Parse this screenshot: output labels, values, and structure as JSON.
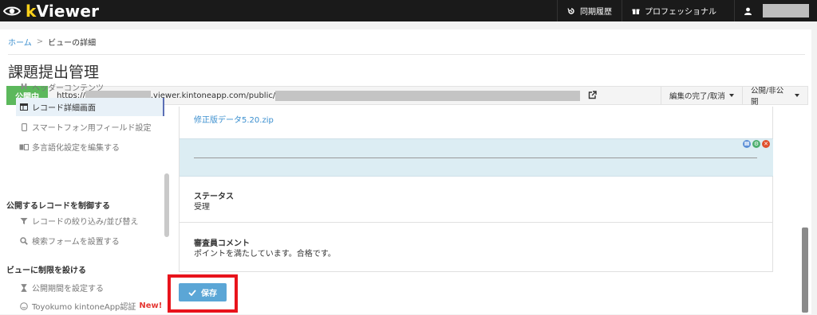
{
  "app": {
    "logo_k": "k",
    "logo_rest": "Viewer"
  },
  "topnav": {
    "sync_history": "同期履歴",
    "professional": "プロフェッショナル"
  },
  "breadcrumb": {
    "home": "ホーム",
    "separator": ">",
    "current": "ビューの詳細"
  },
  "page": {
    "title": "課題提出管理"
  },
  "urlbar": {
    "status_badge": "公開中",
    "url_prefix": "https://",
    "url_mid": ".viewer.kintoneapp.com/public/",
    "edit_done_label": "編集の完了/取消",
    "publish_label": "公開/非公開"
  },
  "sidebar": {
    "items_top": [
      {
        "label": "ヘッダーコンテンツ",
        "icon": "H"
      },
      {
        "label": "レコード詳細画面",
        "icon": "table-icon",
        "active": true
      },
      {
        "label": "スマートフォン用フィールド設定",
        "icon": "phone-icon"
      },
      {
        "label": "多言語化設定を編集する",
        "icon": "language-icon"
      }
    ],
    "section_control": "公開するレコードを制御する",
    "items_control": [
      {
        "label": "レコードの絞り込み/並び替え",
        "icon": "filter-icon"
      },
      {
        "label": "検索フォームを設置する",
        "icon": "search-icon"
      }
    ],
    "section_restrict": "ビューに制限を設ける",
    "items_restrict": [
      {
        "label": "公開期間を設定する",
        "icon": "hourglass-icon"
      },
      {
        "label": "Toyokumo kintoneApp認証",
        "icon": "smile-icon",
        "badge": "New!"
      }
    ]
  },
  "content": {
    "file_link": "修正版データ5.20.zip",
    "status_label": "ステータス",
    "status_value": "受理",
    "comment_label": "審査員コメント",
    "comment_value": "ポイントを満たしています。合格です。"
  },
  "actions": {
    "save_label": "保存"
  },
  "colors": {
    "accent": "#5ba6d6",
    "published": "#5cb85c",
    "highlight_frame": "#e8141c",
    "row_bg": "#dcedf3"
  }
}
